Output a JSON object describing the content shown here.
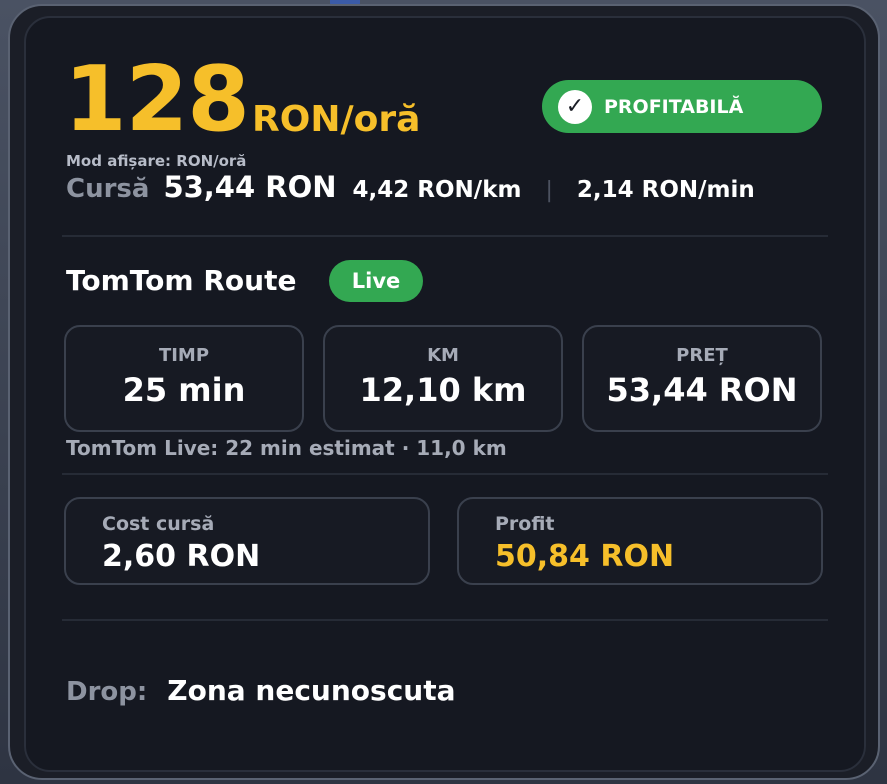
{
  "header": {
    "rate_value": "128",
    "rate_unit": "RON/oră",
    "status_badge": "PROFITABILĂ",
    "status_icon": "checkmark-icon",
    "display_mode": "Mod afișare: RON/oră"
  },
  "trip": {
    "label": "Cursă",
    "price": "53,44 RON",
    "per_km": "4,42 RON/km",
    "separator": "|",
    "per_min": "2,14 RON/min"
  },
  "route": {
    "title": "TomTom Route",
    "live_label": "Live",
    "stats": [
      {
        "label": "TIMP",
        "value": "25 min"
      },
      {
        "label": "KM",
        "value": "12,10 km"
      },
      {
        "label": "PREȚ",
        "value": "53,44 RON"
      }
    ],
    "live_note": "TomTom Live: 22 min estimat · 11,0 km"
  },
  "finance": {
    "cost_label": "Cost cursă",
    "cost_value": "2,60 RON",
    "profit_label": "Profit",
    "profit_value": "50,84 RON"
  },
  "drop": {
    "label": "Drop:",
    "value": "Zona necunoscuta"
  },
  "colors": {
    "accent": "#f6bf2a",
    "success": "#33a852",
    "panel_bg": "#151821"
  }
}
